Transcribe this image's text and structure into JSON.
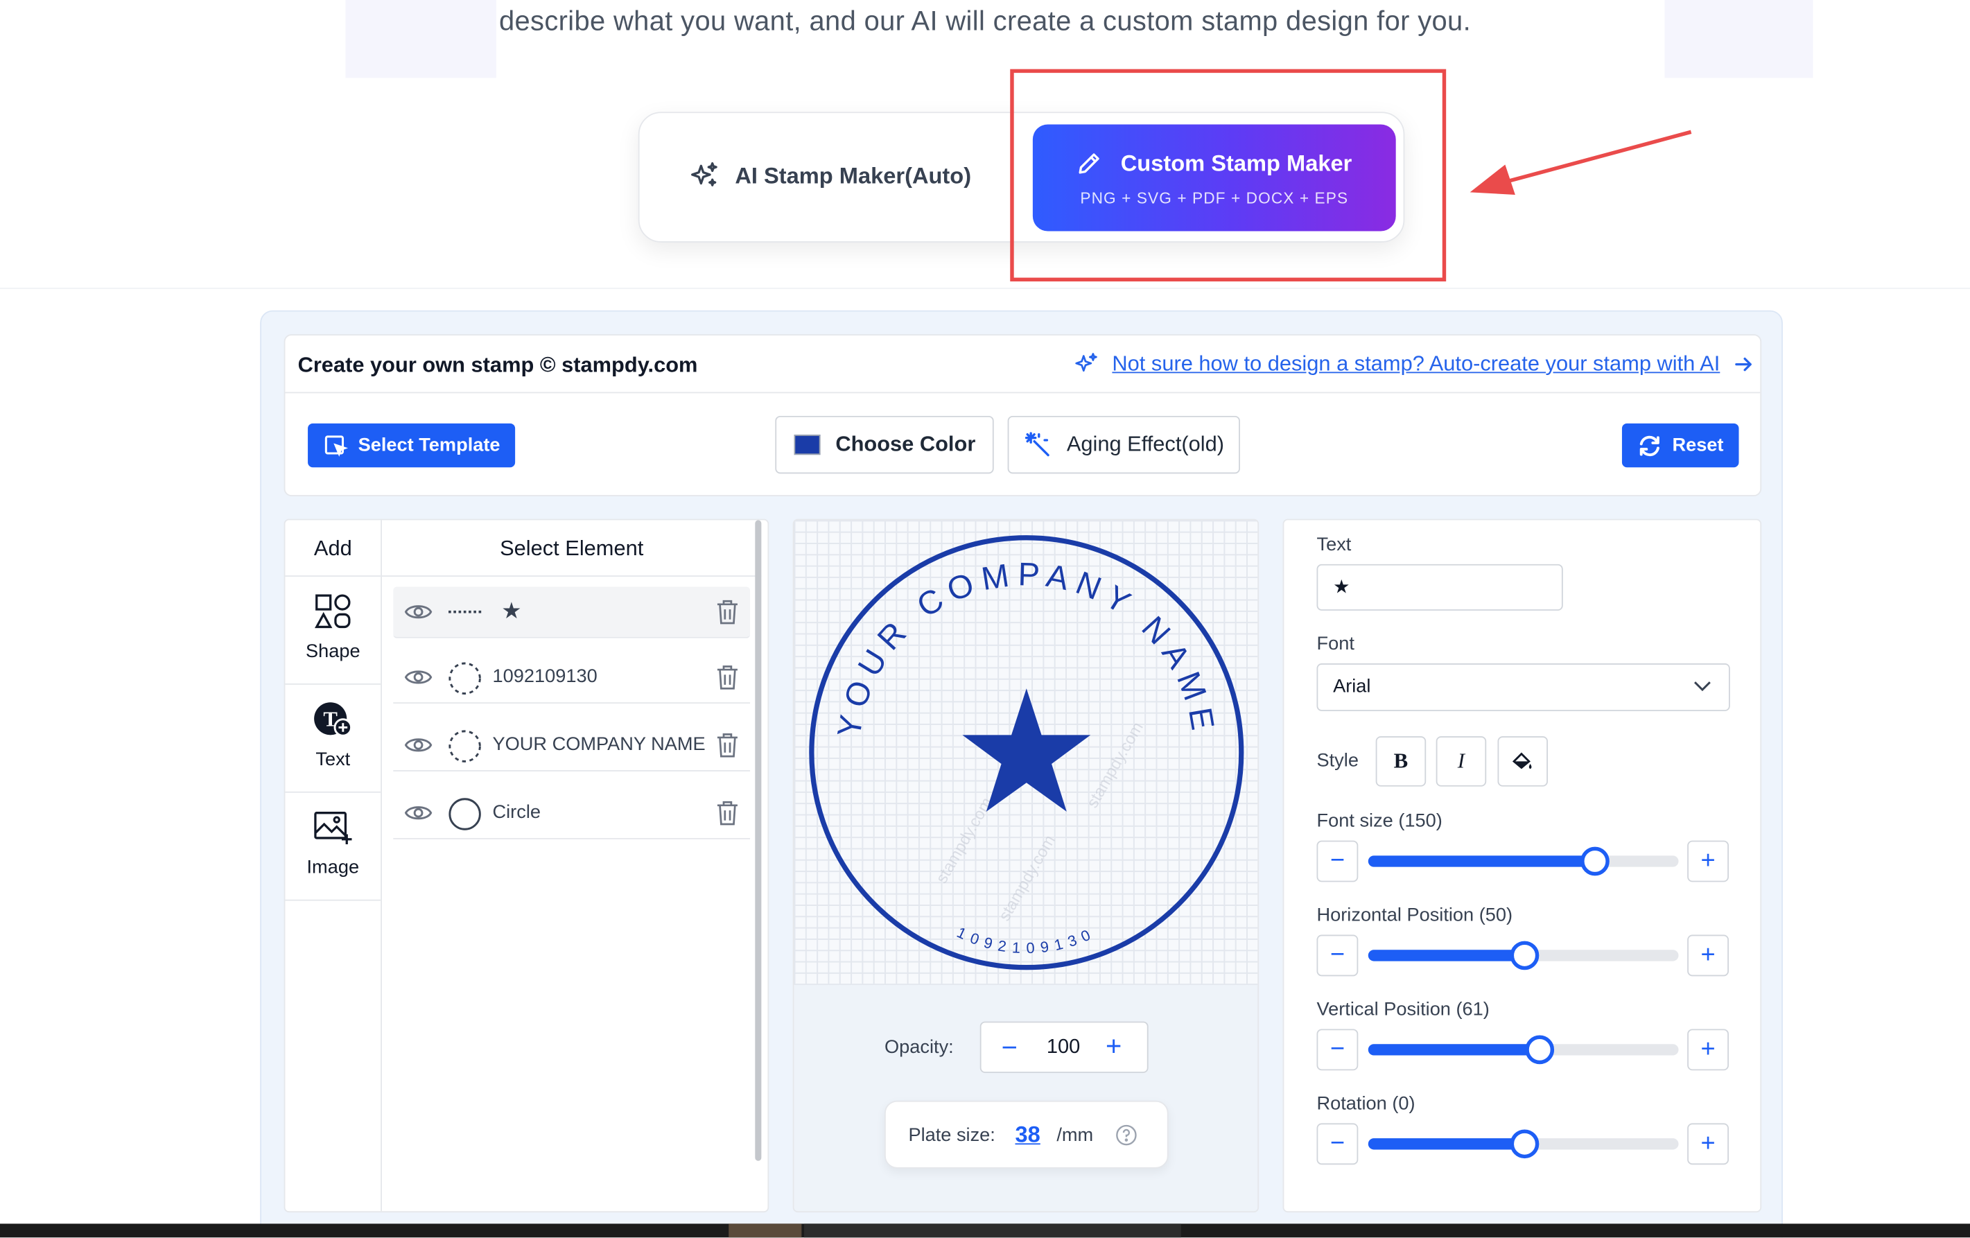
{
  "intro_text": "describe what you want, and our AI will create a custom stamp design for you.",
  "modes": {
    "auto_label": "AI Stamp Maker(Auto)",
    "custom_label": "Custom Stamp Maker",
    "custom_formats": "PNG + SVG + PDF + DOCX + EPS"
  },
  "editor": {
    "brand": "Create your own stamp © stampdy.com",
    "auto_link": "Not sure how to design a stamp? Auto-create your stamp with AI",
    "toolbar": {
      "select_template": "Select Template",
      "choose_color": "Choose Color",
      "aging_effect": "Aging Effect(old)",
      "reset": "Reset"
    },
    "add_panel": {
      "header": "Add",
      "tools": [
        "Shape",
        "Text",
        "Image"
      ]
    },
    "elements_panel": {
      "header": "Select Element",
      "items": [
        {
          "label": "★",
          "thumb": "dashed-line"
        },
        {
          "label": "1092109130",
          "thumb": "dashed-circle"
        },
        {
          "label": "YOUR COMPANY NAME",
          "thumb": "dashed-circle"
        },
        {
          "label": "Circle",
          "thumb": "circle"
        }
      ]
    },
    "canvas": {
      "stamp_top_text": "YOUR COMPANY NAME",
      "stamp_bottom_text": "1092109130",
      "opacity_label": "Opacity:",
      "opacity_value": "100",
      "plate_label": "Plate size:",
      "plate_value": "38",
      "plate_unit": "/mm"
    },
    "properties": {
      "text_label": "Text",
      "text_value": "★",
      "font_label": "Font",
      "font_value": "Arial",
      "style_label": "Style",
      "bold": "B",
      "italic": "I",
      "font_size_label": "Font size (150)",
      "font_size_level": 0.73,
      "hpos_label": "Horizontal Position (50)",
      "hpos_level": 0.5,
      "vpos_label": "Vertical Position (61)",
      "vpos_level": 0.55,
      "rotation_label": "Rotation (0)",
      "rotation_level": 0.5,
      "minus": "−",
      "plus": "+"
    }
  },
  "colors": {
    "accent": "#1d5ef5",
    "stamp": "#1a3ca8",
    "highlight": "#ea4b4b"
  }
}
